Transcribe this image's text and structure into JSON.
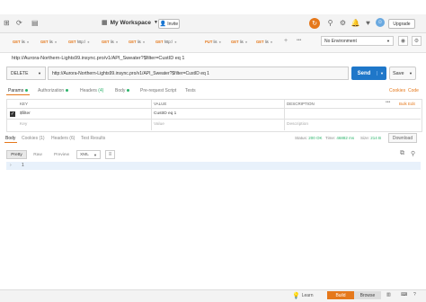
{
  "header": {
    "workspace": "My Workspace",
    "invite": "Invite",
    "upgrade": "Upgrade",
    "colors": {
      "accent": "#e5781b",
      "send": "#1f77c9",
      "status_ok": "#2bb36a"
    }
  },
  "tabs": [
    {
      "method": "GET",
      "label": "lis"
    },
    {
      "method": "GET",
      "label": "lis"
    },
    {
      "method": "GET",
      "label": "http:/"
    },
    {
      "method": "GET",
      "label": "lis"
    },
    {
      "method": "GET",
      "label": "lis"
    },
    {
      "method": "GET",
      "label": "http:/"
    },
    {
      "method": "PUT",
      "label": "lis"
    },
    {
      "method": "GET",
      "label": "lis"
    },
    {
      "method": "GET",
      "label": "lis"
    }
  ],
  "environment": {
    "selected": "No Environment"
  },
  "request": {
    "title": "http://Aurora-Northern-Lights99.insync.pro/v1/API_Sweater?$filter=CustID eq 1",
    "method": "DELETE",
    "url": "http://Aurora-Northern-Lights99.insync.pro/v1/API_Sweater?$filter=CustID eq 1",
    "send": "Send",
    "save": "Save"
  },
  "request_tabs": {
    "params": "Params",
    "authorization": "Authorization",
    "headers": "Headers",
    "headers_count": "(4)",
    "body": "Body",
    "prerequest": "Pre-request Script",
    "tests": "Tests",
    "cookies": "Cookies",
    "code": "Code"
  },
  "params_table": {
    "headers": [
      "KEY",
      "VALUE",
      "DESCRIPTION"
    ],
    "bulk_edit": "Bulk Edit",
    "rows": [
      {
        "key": "$filter",
        "value": "CustID eq 1",
        "description": ""
      }
    ],
    "placeholder": {
      "key": "Key",
      "value": "Value",
      "description": "Description"
    }
  },
  "response": {
    "tabs": {
      "body": "Body",
      "cookies": "Cookies",
      "cookies_count": "(1)",
      "headers": "Headers",
      "headers_count": "(6)",
      "test_results": "Test Results"
    },
    "status_label": "Status:",
    "status_value": "200 OK",
    "time_label": "Time:",
    "time_value": "46882 ms",
    "size_label": "Size:",
    "size_value": "214 B",
    "download": "Download",
    "formats": [
      "Pretty",
      "Raw",
      "Preview"
    ],
    "format_type": "XML",
    "line_number": "1"
  },
  "footer": {
    "learn": "Learn",
    "build": "Build",
    "browse": "Browse"
  }
}
